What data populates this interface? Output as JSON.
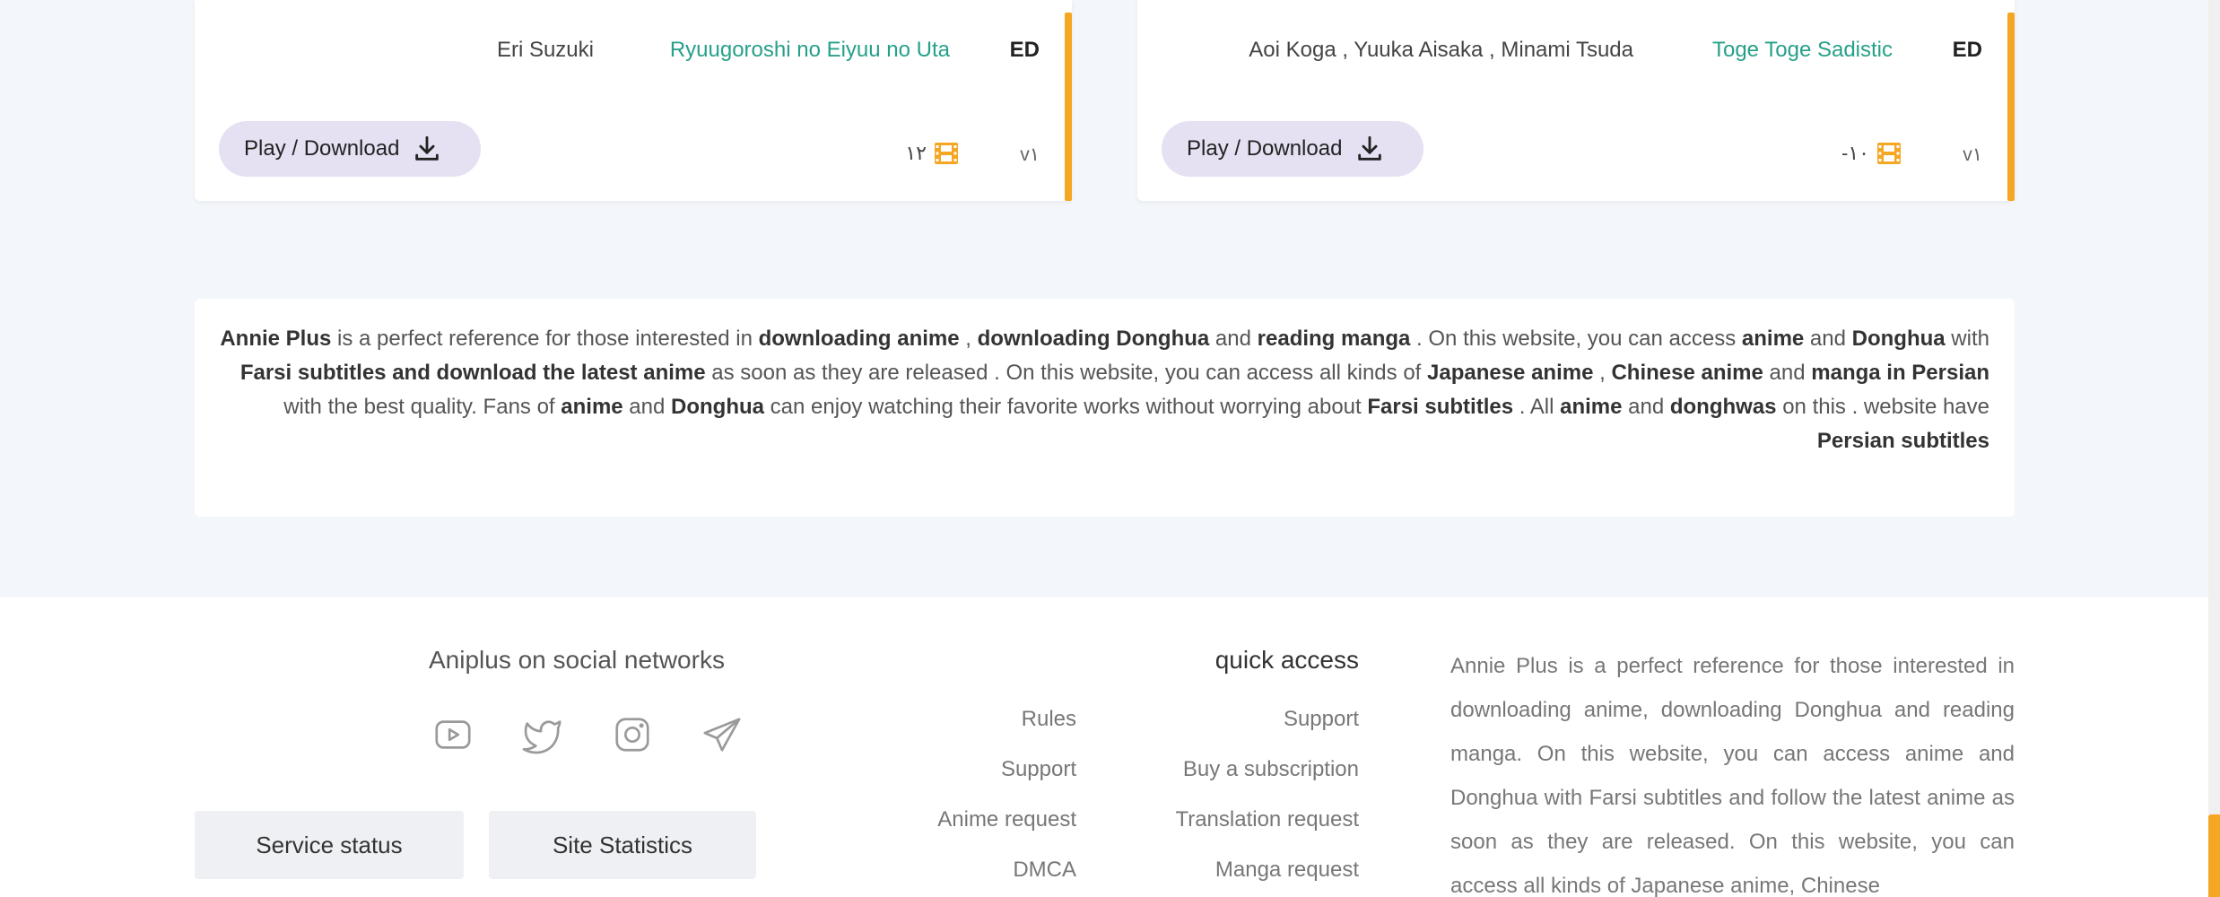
{
  "cards": [
    {
      "type": "ED",
      "title": "Ryuugoroshi no Eiyuu no Uta",
      "artist": "Eri Suzuki",
      "play_label": "Play / Download",
      "episodes": "۱۲",
      "version": "v۱"
    },
    {
      "type": "ED",
      "title": "Toge Toge Sadistic",
      "artist": "Aoi Koga , Yuuka Aisaka , Minami Tsuda",
      "play_label": "Play / Download",
      "episodes": "-۱۰",
      "version": "v۱"
    }
  ],
  "description": {
    "segments": [
      {
        "t": "Annie Plus",
        "b": true
      },
      {
        "t": " is a perfect reference for those interested in ",
        "b": false
      },
      {
        "t": "downloading anime",
        "b": true
      },
      {
        "t": " , ",
        "b": false
      },
      {
        "t": "downloading Donghua",
        "b": true
      },
      {
        "t": " and ",
        "b": false
      },
      {
        "t": "reading manga",
        "b": true
      },
      {
        "t": " . On this website, you can access  ",
        "b": false
      },
      {
        "t": "anime",
        "b": true
      },
      {
        "t": " and ",
        "b": false
      },
      {
        "t": "Donghua",
        "b": true
      },
      {
        "t": " with ",
        "b": false
      },
      {
        "t": "Farsi subtitles and download the latest anime",
        "b": true
      },
      {
        "t": " as soon as they are released . On this website, you can access all kinds of ",
        "b": false
      },
      {
        "t": "Japanese anime",
        "b": true
      },
      {
        "t": " , ",
        "b": false
      },
      {
        "t": "Chinese anime",
        "b": true
      },
      {
        "t": " and ",
        "b": false
      },
      {
        "t": "manga in Persian",
        "b": true
      },
      {
        "t": " with the best quality. Fans of ",
        "b": false
      },
      {
        "t": "anime",
        "b": true
      },
      {
        "t": " and ",
        "b": false
      },
      {
        "t": "Donghua",
        "b": true
      },
      {
        "t": " can enjoy watching their favorite works without worrying about ",
        "b": false
      },
      {
        "t": "Farsi subtitles",
        "b": true
      },
      {
        "t": " . All ",
        "b": false
      },
      {
        "t": "anime",
        "b": true
      },
      {
        "t": " and ",
        "b": false
      },
      {
        "t": "donghwas",
        "b": true
      },
      {
        "t": " on this . website have ",
        "b": false
      },
      {
        "t": "Persian subtitles",
        "b": true
      }
    ]
  },
  "footer": {
    "social_title": "Aniplus on social networks",
    "social_icons": [
      "youtube-icon",
      "twitter-icon",
      "instagram-icon",
      "telegram-icon"
    ],
    "service_status_label": "Service status",
    "site_statistics_label": "Site Statistics",
    "quick_access_title": "quick access",
    "quick_links_col1": [
      "Support",
      "Buy a subscription",
      "Translation request",
      "Manga request"
    ],
    "quick_links_col2": [
      "Rules",
      "Support",
      "Anime request",
      "DMCA"
    ],
    "about_text": "Annie Plus is a perfect reference for those interested in downloading anime, downloading Donghua and reading manga. On this website, you can access anime and Donghua with Farsi subtitles and follow the latest anime as soon as they are released. On this website, you can access all kinds of Japanese anime, Chinese"
  },
  "colors": {
    "accent": "#f5a623",
    "title_green": "#27a08a",
    "play_button_bg": "#e5e1f2",
    "page_bg": "#f3f6fa"
  }
}
